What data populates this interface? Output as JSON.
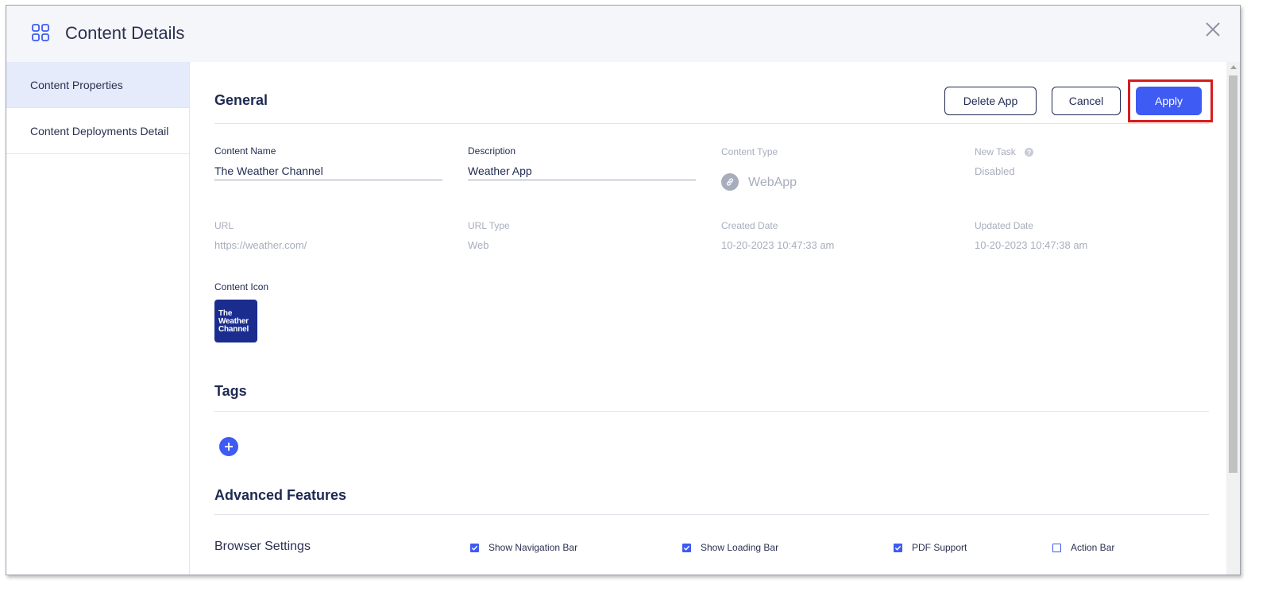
{
  "header": {
    "title": "Content Details"
  },
  "sidebar": {
    "items": [
      {
        "label": "Content Properties"
      },
      {
        "label": "Content Deployments Detail"
      }
    ]
  },
  "general": {
    "title": "General",
    "buttons": {
      "delete": "Delete App",
      "cancel": "Cancel",
      "apply": "Apply"
    },
    "content_name": {
      "label": "Content Name",
      "value": "The Weather Channel"
    },
    "description": {
      "label": "Description",
      "value": "Weather App"
    },
    "content_type": {
      "label": "Content Type",
      "value": "WebApp"
    },
    "new_task": {
      "label": "New Task",
      "value": "Disabled"
    },
    "url": {
      "label": "URL",
      "value": "https://weather.com/"
    },
    "url_type": {
      "label": "URL Type",
      "value": "Web"
    },
    "created_date": {
      "label": "Created Date",
      "value": "10-20-2023 10:47:33 am"
    },
    "updated_date": {
      "label": "Updated Date",
      "value": "10-20-2023 10:47:38 am"
    },
    "content_icon": {
      "label": "Content Icon",
      "icon_lines": [
        "The",
        "Weather",
        "Channel"
      ]
    }
  },
  "tags": {
    "title": "Tags"
  },
  "advanced": {
    "title": "Advanced Features",
    "browser_settings": {
      "label": "Browser Settings",
      "options": [
        {
          "label": "Show Navigation Bar",
          "checked": true
        },
        {
          "label": "Show Loading Bar",
          "checked": true
        },
        {
          "label": "PDF Support",
          "checked": true
        },
        {
          "label": "Action Bar",
          "checked": false
        }
      ]
    }
  },
  "colors": {
    "accent": "#3e5bf3",
    "highlight": "#d81c1c",
    "navy": "#1f2a52",
    "icon_bg": "#1a2d8f"
  }
}
